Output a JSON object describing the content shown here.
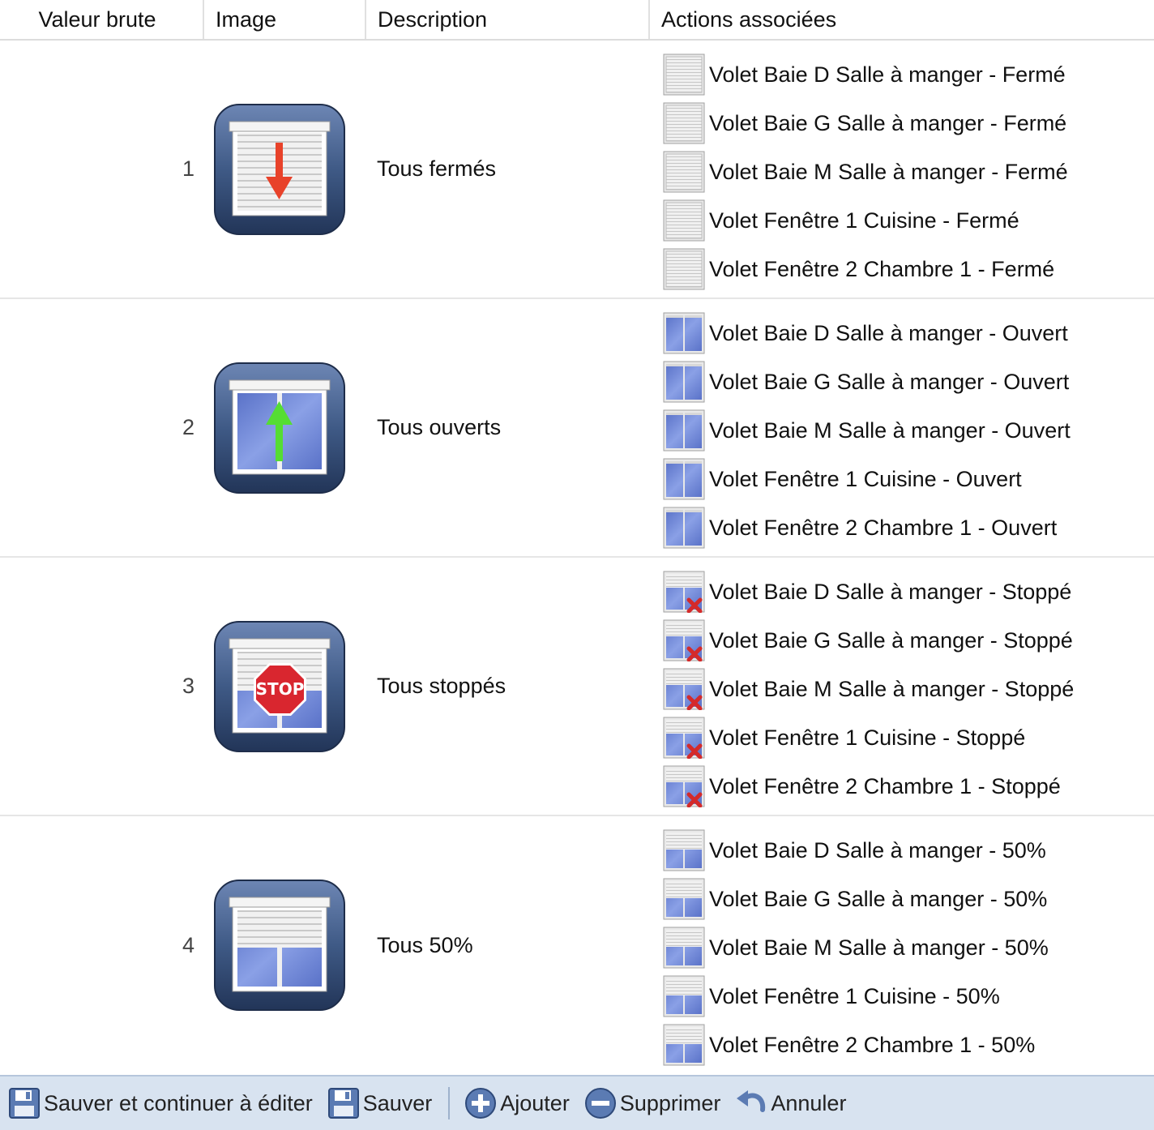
{
  "table": {
    "headers": {
      "raw_value": "Valeur brute",
      "image": "Image",
      "description": "Description",
      "actions": "Actions associées"
    },
    "rows": [
      {
        "value": "1",
        "image_icon": "shutter-closed-arrow-down-icon",
        "description": "Tous fermés",
        "actions": [
          {
            "icon": "shutter-closed-icon",
            "label": "Volet Baie D Salle à manger - Fermé"
          },
          {
            "icon": "shutter-closed-icon",
            "label": "Volet Baie G Salle à manger - Fermé"
          },
          {
            "icon": "shutter-closed-icon",
            "label": "Volet Baie M Salle à manger - Fermé"
          },
          {
            "icon": "shutter-closed-icon",
            "label": "Volet Fenêtre 1 Cuisine - Fermé"
          },
          {
            "icon": "shutter-closed-icon",
            "label": "Volet Fenêtre 2 Chambre 1 - Fermé"
          }
        ]
      },
      {
        "value": "2",
        "image_icon": "shutter-open-arrow-up-icon",
        "description": "Tous ouverts",
        "actions": [
          {
            "icon": "shutter-open-icon",
            "label": "Volet Baie D Salle à manger - Ouvert"
          },
          {
            "icon": "shutter-open-icon",
            "label": "Volet Baie G Salle à manger - Ouvert"
          },
          {
            "icon": "shutter-open-icon",
            "label": "Volet Baie M Salle à manger - Ouvert"
          },
          {
            "icon": "shutter-open-icon",
            "label": "Volet Fenêtre 1 Cuisine - Ouvert"
          },
          {
            "icon": "shutter-open-icon",
            "label": "Volet Fenêtre 2 Chambre 1 - Ouvert"
          }
        ]
      },
      {
        "value": "3",
        "image_icon": "shutter-stop-sign-icon",
        "image_text": "STOP",
        "description": "Tous stoppés",
        "actions": [
          {
            "icon": "shutter-stopped-icon",
            "label": "Volet Baie D Salle à manger - Stoppé"
          },
          {
            "icon": "shutter-stopped-icon",
            "label": "Volet Baie G Salle à manger - Stoppé"
          },
          {
            "icon": "shutter-stopped-icon",
            "label": "Volet Baie M Salle à manger - Stoppé"
          },
          {
            "icon": "shutter-stopped-icon",
            "label": "Volet Fenêtre 1 Cuisine - Stoppé"
          },
          {
            "icon": "shutter-stopped-icon",
            "label": "Volet Fenêtre 2 Chambre 1 - Stoppé"
          }
        ]
      },
      {
        "value": "4",
        "image_icon": "shutter-half-icon",
        "description": "Tous 50%",
        "actions": [
          {
            "icon": "shutter-half-icon",
            "label": "Volet Baie D Salle à manger - 50%"
          },
          {
            "icon": "shutter-half-icon",
            "label": "Volet Baie G Salle à manger - 50%"
          },
          {
            "icon": "shutter-half-icon",
            "label": "Volet Baie M Salle à manger - 50%"
          },
          {
            "icon": "shutter-half-icon",
            "label": "Volet Fenêtre 1 Cuisine - 50%"
          },
          {
            "icon": "shutter-half-icon",
            "label": "Volet Fenêtre 2 Chambre 1 - 50%"
          }
        ]
      }
    ]
  },
  "toolbar": {
    "save_continue": {
      "icon": "floppy-disk-icon",
      "label": "Sauver et continuer à éditer"
    },
    "save": {
      "icon": "floppy-disk-icon",
      "label": "Sauver"
    },
    "add": {
      "icon": "plus-circle-icon",
      "label": "Ajouter"
    },
    "delete": {
      "icon": "minus-circle-icon",
      "label": "Supprimer"
    },
    "cancel": {
      "icon": "undo-arrow-icon",
      "label": "Annuler"
    }
  },
  "colors": {
    "icon_frame": "#3f5a86",
    "glass_blue": "#6e86d6",
    "arrow_down": "#e8422a",
    "arrow_up": "#55dd33",
    "stop_red": "#d9262f",
    "toolbar_bg": "#d8e3f0"
  }
}
